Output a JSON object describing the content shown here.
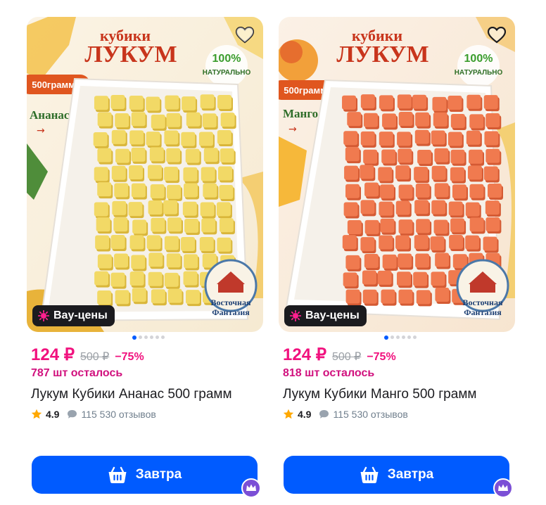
{
  "products": [
    {
      "image": {
        "headline_top": "кубики",
        "headline_main": "ЛУКУМ",
        "weight_tag": "500грамм",
        "flavor": "Ананас",
        "natural_percent": "100%",
        "natural_word": "НАТУРАЛЬНО",
        "brand_line1": "Восточная",
        "brand_line2": "Фантазия",
        "cube_color": "#f2d966",
        "cube_shade": "#d9b63a",
        "fruit_color": "#f5c84a"
      },
      "badge_label": "Вау-цены",
      "price_now": "124 ₽",
      "price_old": "500 ₽",
      "discount": "−75%",
      "stock_text": "787 шт осталось",
      "title": "Лукум Кубики Ананас 500 грамм",
      "rating": "4.9",
      "reviews": "115 530 отзывов",
      "button_label": "Завтра",
      "carousel_active_index": 0,
      "carousel_count": 6
    },
    {
      "image": {
        "headline_top": "кубики",
        "headline_main": "ЛУКУМ",
        "weight_tag": "500грамм",
        "flavor": "Манго",
        "natural_percent": "100%",
        "natural_word": "НАТУРАЛЬНО",
        "brand_line1": "Восточная",
        "brand_line2": "Фантазия",
        "cube_color": "#f07a4f",
        "cube_shade": "#d45a33",
        "fruit_color": "#f6b23a"
      },
      "badge_label": "Вау-цены",
      "price_now": "124 ₽",
      "price_old": "500 ₽",
      "discount": "−75%",
      "stock_text": "818 шт осталось",
      "title": "Лукум Кубики Манго 500 грамм",
      "rating": "4.9",
      "reviews": "115 530 отзывов",
      "button_label": "Завтра",
      "carousel_active_index": 0,
      "carousel_count": 6
    }
  ],
  "colors": {
    "accent": "#005bff",
    "price": "#f1117e",
    "badge_bg": "#1b1b1f",
    "star": "#ffa800",
    "premium": "#7b4fd6"
  },
  "icons": {
    "favorite": "heart-outline-icon",
    "badge": "sparkle-icon",
    "rating": "star-icon",
    "reviews": "chat-bubble-icon",
    "button": "basket-icon",
    "premium": "crown-icon"
  }
}
